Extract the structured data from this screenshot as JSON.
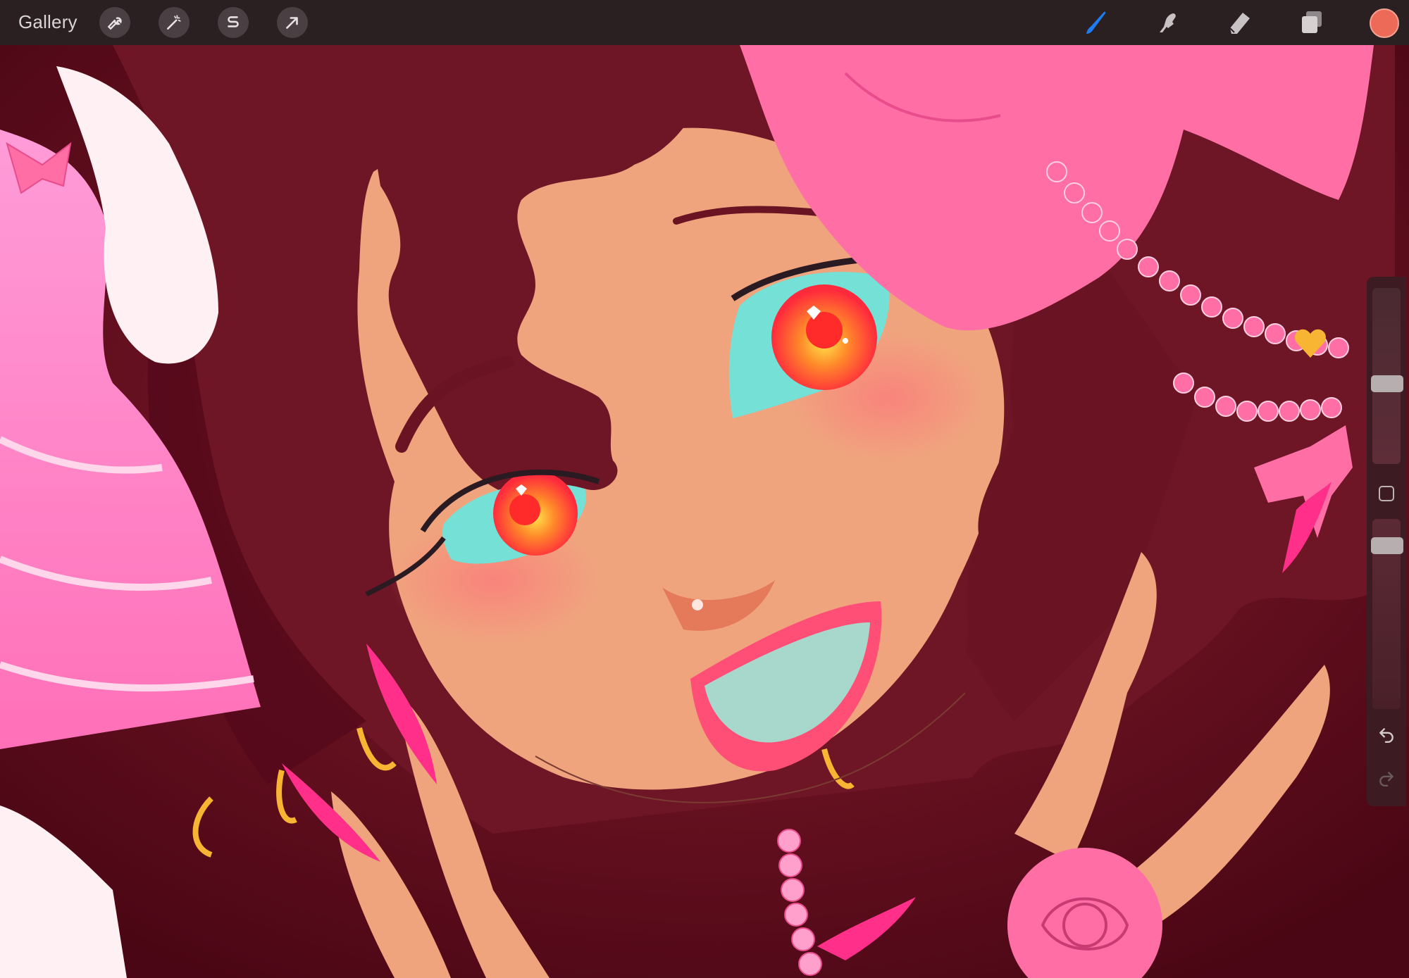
{
  "toolbar": {
    "gallery_label": "Gallery",
    "left_tools": [
      "wrench-icon",
      "magic-wand-icon",
      "selection-s-icon",
      "transform-arrow-icon"
    ],
    "right_tools": [
      "brush-icon",
      "smudge-icon",
      "eraser-icon",
      "layers-icon"
    ],
    "active_tool": "brush-icon",
    "accent_color": "#1d7cf2",
    "current_color": "#ec6a57"
  },
  "sidebar": {
    "controls": [
      "brush-size-slider",
      "modify-button",
      "opacity-slider",
      "undo-icon",
      "redo-icon"
    ]
  },
  "canvas": {
    "palette": {
      "background": "#5a0d1c",
      "hair": "#6e1625",
      "skin": "#f0a47e",
      "pink": "#ff6fa6",
      "eye_white": "#74e0d6",
      "iris": "#ff3d3d"
    }
  }
}
